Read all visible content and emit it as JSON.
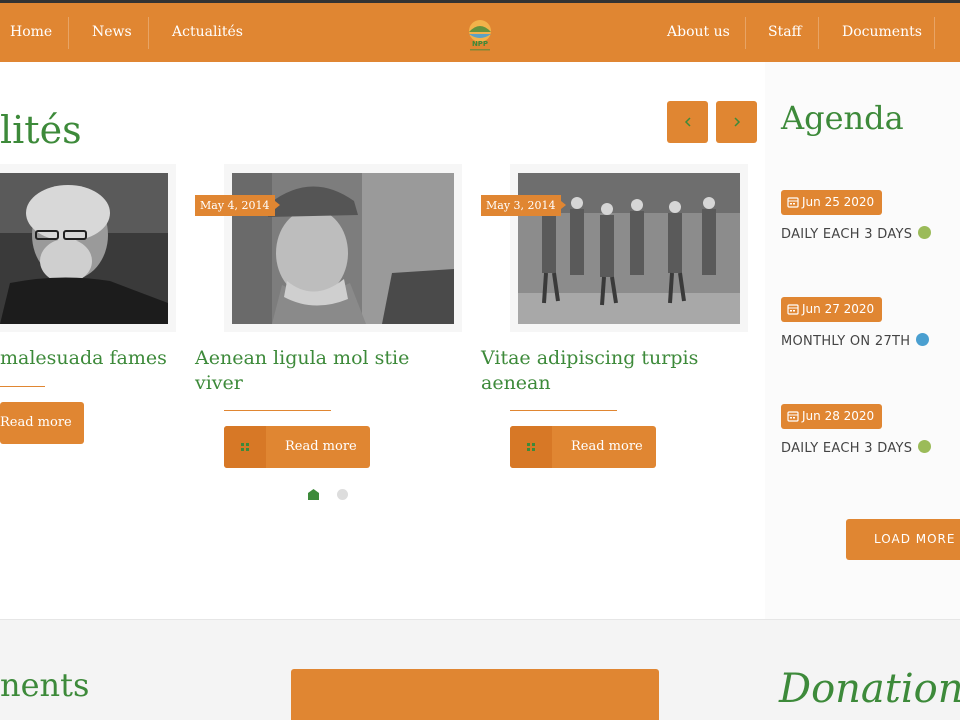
{
  "nav": {
    "left": [
      "Home",
      "News",
      "Actualités"
    ],
    "right": [
      "About us",
      "Staff",
      "Documents"
    ],
    "logo_text": "NPP"
  },
  "news": {
    "section_title": "lités",
    "prev_icon": "chevron-left-icon",
    "next_icon": "chevron-right-icon",
    "cards": [
      {
        "title": "malesuada fames",
        "date": "",
        "read_more": "Read more"
      },
      {
        "title": "Aenean ligula mol stie viver",
        "date": "May 4, 2014",
        "read_more": "Read more"
      },
      {
        "title": "Vitae adipiscing turpis aenean",
        "date": "May 3, 2014",
        "read_more": "Read more"
      }
    ],
    "pagination": {
      "pages": 2,
      "active": 1
    }
  },
  "agenda": {
    "title": "Agenda",
    "events": [
      {
        "date": "Jun 25 2020",
        "recurrence": "DAILY EACH 3 DAYS",
        "dot_color": "#9bbb59"
      },
      {
        "date": "Jun 27 2020",
        "recurrence": "MONTHLY ON 27TH",
        "dot_color": "#4a9fd0"
      },
      {
        "date": "Jun 28 2020",
        "recurrence": "DAILY EACH 3 DAYS",
        "dot_color": "#9bbb59"
      }
    ],
    "load_more": "LOAD MORE"
  },
  "bottom": {
    "left_title": "nents",
    "right_title": "Donation"
  },
  "colors": {
    "accent": "#e08632",
    "brand_green": "#3d8a3a",
    "text_dark": "#444444"
  }
}
